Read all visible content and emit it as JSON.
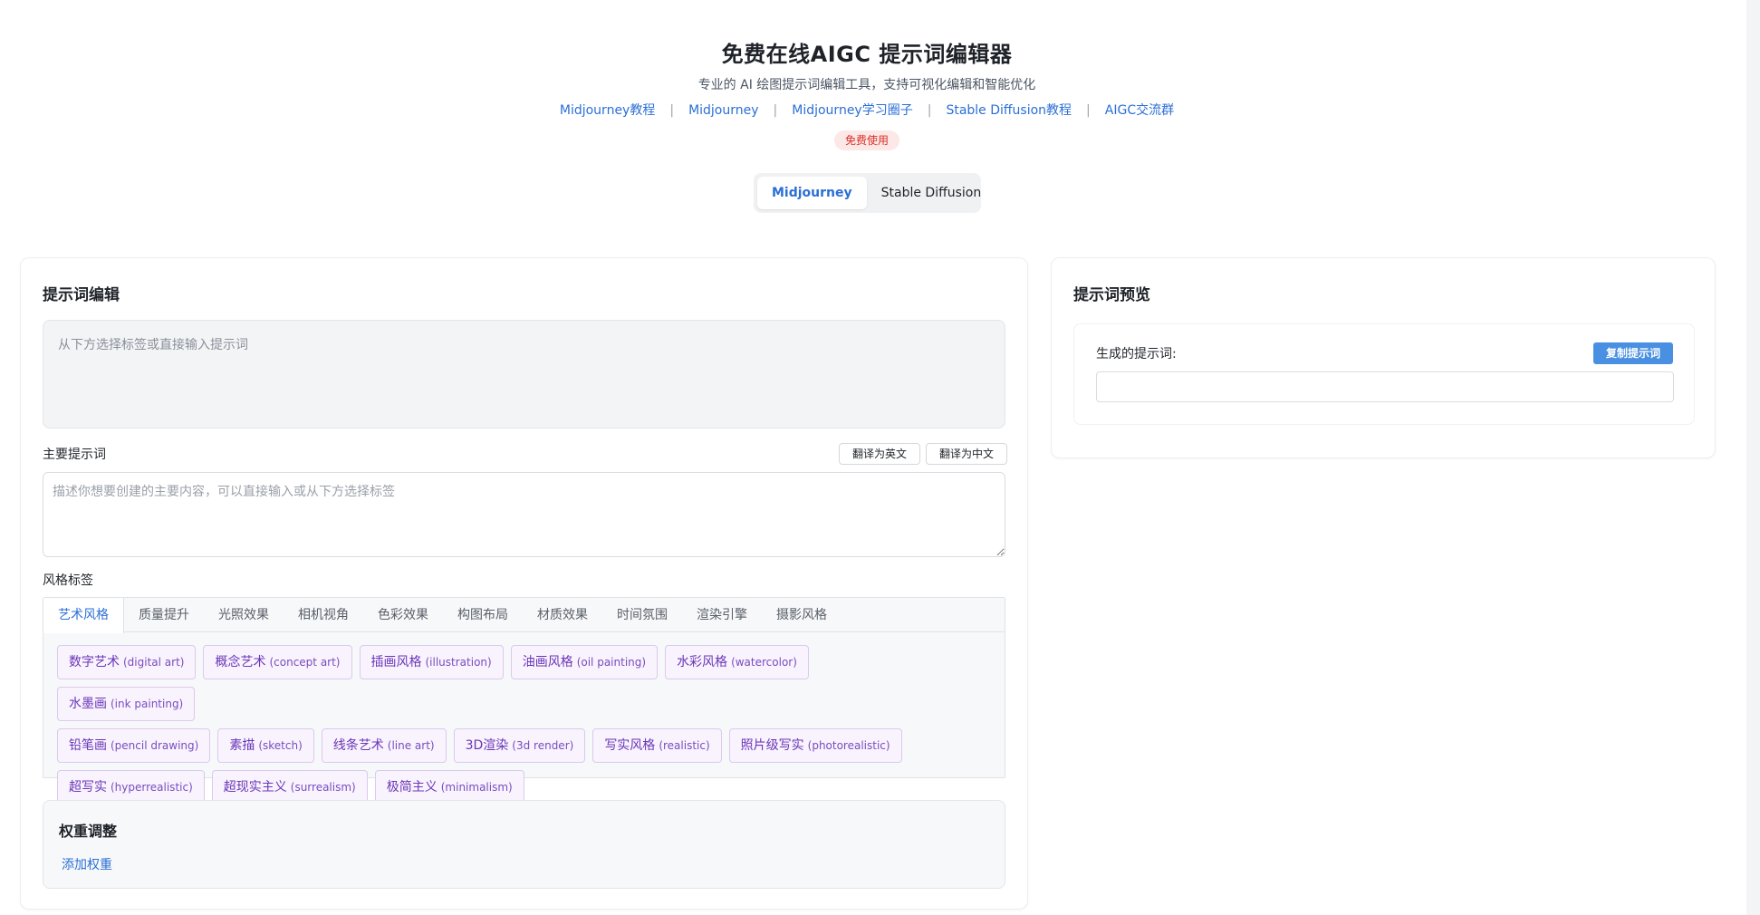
{
  "header": {
    "title": "免费在线AIGC 提示词编辑器",
    "subtitle": "专业的 AI 绘图提示词编辑工具，支持可视化编辑和智能优化",
    "links": [
      "Midjourney教程",
      "Midjourney",
      "Midjourney学习圈子",
      "Stable Diffusion教程",
      "AIGC交流群"
    ],
    "separator": "|",
    "badge": "免费使用"
  },
  "mode_tabs": [
    "Midjourney",
    "Stable Diffusion"
  ],
  "editor": {
    "title": "提示词编辑",
    "prompt_placeholder": "从下方选择标签或直接输入提示词",
    "main_label": "主要提示词",
    "translate_en": "翻译为英文",
    "translate_zh": "翻译为中文",
    "main_placeholder": "描述你想要创建的主要内容，可以直接输入或从下方选择标签",
    "style_label": "风格标签",
    "style_tabs": [
      "艺术风格",
      "质量提升",
      "光照效果",
      "相机视角",
      "色彩效果",
      "构图布局",
      "材质效果",
      "时间氛围",
      "渲染引擎",
      "摄影风格"
    ],
    "tags": [
      {
        "zh": "数字艺术",
        "en": "(digital art)"
      },
      {
        "zh": "概念艺术",
        "en": "(concept art)"
      },
      {
        "zh": "插画风格",
        "en": "(illustration)"
      },
      {
        "zh": "油画风格",
        "en": "(oil painting)"
      },
      {
        "zh": "水彩风格",
        "en": "(watercolor)"
      },
      {
        "zh": "水墨画",
        "en": "(ink painting)"
      },
      {
        "zh": "铅笔画",
        "en": "(pencil drawing)"
      },
      {
        "zh": "素描",
        "en": "(sketch)"
      },
      {
        "zh": "线条艺术",
        "en": "(line art)"
      },
      {
        "zh": "3D渲染",
        "en": "(3d render)"
      },
      {
        "zh": "写实风格",
        "en": "(realistic)"
      },
      {
        "zh": "照片级写实",
        "en": "(photorealistic)"
      },
      {
        "zh": "超写实",
        "en": "(hyperrealistic)"
      },
      {
        "zh": "超现实主义",
        "en": "(surrealism)"
      },
      {
        "zh": "极简主义",
        "en": "(minimalism)"
      }
    ],
    "weight_title": "权重调整",
    "weight_link": "添加权重"
  },
  "preview": {
    "title": "提示词预览",
    "label": "生成的提示词:",
    "copy_button": "复制提示词",
    "output": ""
  },
  "colors": {
    "accent": "#2b6fd6",
    "tag_text": "#6b36b8",
    "badge_bg": "#fde8e8",
    "badge_text": "#d93025",
    "copy_button": "#4a90e2"
  }
}
